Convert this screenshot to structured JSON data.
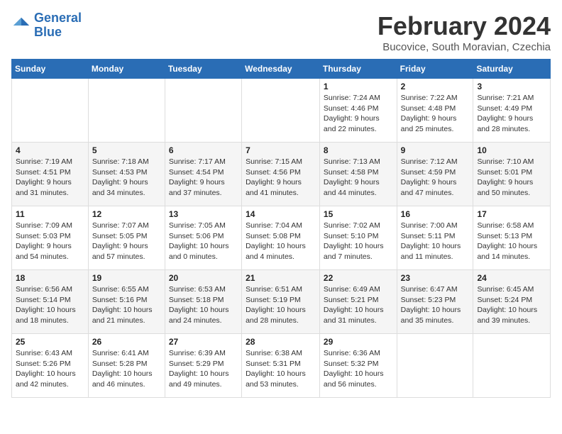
{
  "logo": {
    "line1": "General",
    "line2": "Blue"
  },
  "calendar": {
    "title": "February 2024",
    "subtitle": "Bucovice, South Moravian, Czechia"
  },
  "weekdays": [
    "Sunday",
    "Monday",
    "Tuesday",
    "Wednesday",
    "Thursday",
    "Friday",
    "Saturday"
  ],
  "weeks": [
    [
      {
        "day": "",
        "info": ""
      },
      {
        "day": "",
        "info": ""
      },
      {
        "day": "",
        "info": ""
      },
      {
        "day": "",
        "info": ""
      },
      {
        "day": "1",
        "info": "Sunrise: 7:24 AM\nSunset: 4:46 PM\nDaylight: 9 hours\nand 22 minutes."
      },
      {
        "day": "2",
        "info": "Sunrise: 7:22 AM\nSunset: 4:48 PM\nDaylight: 9 hours\nand 25 minutes."
      },
      {
        "day": "3",
        "info": "Sunrise: 7:21 AM\nSunset: 4:49 PM\nDaylight: 9 hours\nand 28 minutes."
      }
    ],
    [
      {
        "day": "4",
        "info": "Sunrise: 7:19 AM\nSunset: 4:51 PM\nDaylight: 9 hours\nand 31 minutes."
      },
      {
        "day": "5",
        "info": "Sunrise: 7:18 AM\nSunset: 4:53 PM\nDaylight: 9 hours\nand 34 minutes."
      },
      {
        "day": "6",
        "info": "Sunrise: 7:17 AM\nSunset: 4:54 PM\nDaylight: 9 hours\nand 37 minutes."
      },
      {
        "day": "7",
        "info": "Sunrise: 7:15 AM\nSunset: 4:56 PM\nDaylight: 9 hours\nand 41 minutes."
      },
      {
        "day": "8",
        "info": "Sunrise: 7:13 AM\nSunset: 4:58 PM\nDaylight: 9 hours\nand 44 minutes."
      },
      {
        "day": "9",
        "info": "Sunrise: 7:12 AM\nSunset: 4:59 PM\nDaylight: 9 hours\nand 47 minutes."
      },
      {
        "day": "10",
        "info": "Sunrise: 7:10 AM\nSunset: 5:01 PM\nDaylight: 9 hours\nand 50 minutes."
      }
    ],
    [
      {
        "day": "11",
        "info": "Sunrise: 7:09 AM\nSunset: 5:03 PM\nDaylight: 9 hours\nand 54 minutes."
      },
      {
        "day": "12",
        "info": "Sunrise: 7:07 AM\nSunset: 5:05 PM\nDaylight: 9 hours\nand 57 minutes."
      },
      {
        "day": "13",
        "info": "Sunrise: 7:05 AM\nSunset: 5:06 PM\nDaylight: 10 hours\nand 0 minutes."
      },
      {
        "day": "14",
        "info": "Sunrise: 7:04 AM\nSunset: 5:08 PM\nDaylight: 10 hours\nand 4 minutes."
      },
      {
        "day": "15",
        "info": "Sunrise: 7:02 AM\nSunset: 5:10 PM\nDaylight: 10 hours\nand 7 minutes."
      },
      {
        "day": "16",
        "info": "Sunrise: 7:00 AM\nSunset: 5:11 PM\nDaylight: 10 hours\nand 11 minutes."
      },
      {
        "day": "17",
        "info": "Sunrise: 6:58 AM\nSunset: 5:13 PM\nDaylight: 10 hours\nand 14 minutes."
      }
    ],
    [
      {
        "day": "18",
        "info": "Sunrise: 6:56 AM\nSunset: 5:14 PM\nDaylight: 10 hours\nand 18 minutes."
      },
      {
        "day": "19",
        "info": "Sunrise: 6:55 AM\nSunset: 5:16 PM\nDaylight: 10 hours\nand 21 minutes."
      },
      {
        "day": "20",
        "info": "Sunrise: 6:53 AM\nSunset: 5:18 PM\nDaylight: 10 hours\nand 24 minutes."
      },
      {
        "day": "21",
        "info": "Sunrise: 6:51 AM\nSunset: 5:19 PM\nDaylight: 10 hours\nand 28 minutes."
      },
      {
        "day": "22",
        "info": "Sunrise: 6:49 AM\nSunset: 5:21 PM\nDaylight: 10 hours\nand 31 minutes."
      },
      {
        "day": "23",
        "info": "Sunrise: 6:47 AM\nSunset: 5:23 PM\nDaylight: 10 hours\nand 35 minutes."
      },
      {
        "day": "24",
        "info": "Sunrise: 6:45 AM\nSunset: 5:24 PM\nDaylight: 10 hours\nand 39 minutes."
      }
    ],
    [
      {
        "day": "25",
        "info": "Sunrise: 6:43 AM\nSunset: 5:26 PM\nDaylight: 10 hours\nand 42 minutes."
      },
      {
        "day": "26",
        "info": "Sunrise: 6:41 AM\nSunset: 5:28 PM\nDaylight: 10 hours\nand 46 minutes."
      },
      {
        "day": "27",
        "info": "Sunrise: 6:39 AM\nSunset: 5:29 PM\nDaylight: 10 hours\nand 49 minutes."
      },
      {
        "day": "28",
        "info": "Sunrise: 6:38 AM\nSunset: 5:31 PM\nDaylight: 10 hours\nand 53 minutes."
      },
      {
        "day": "29",
        "info": "Sunrise: 6:36 AM\nSunset: 5:32 PM\nDaylight: 10 hours\nand 56 minutes."
      },
      {
        "day": "",
        "info": ""
      },
      {
        "day": "",
        "info": ""
      }
    ]
  ]
}
